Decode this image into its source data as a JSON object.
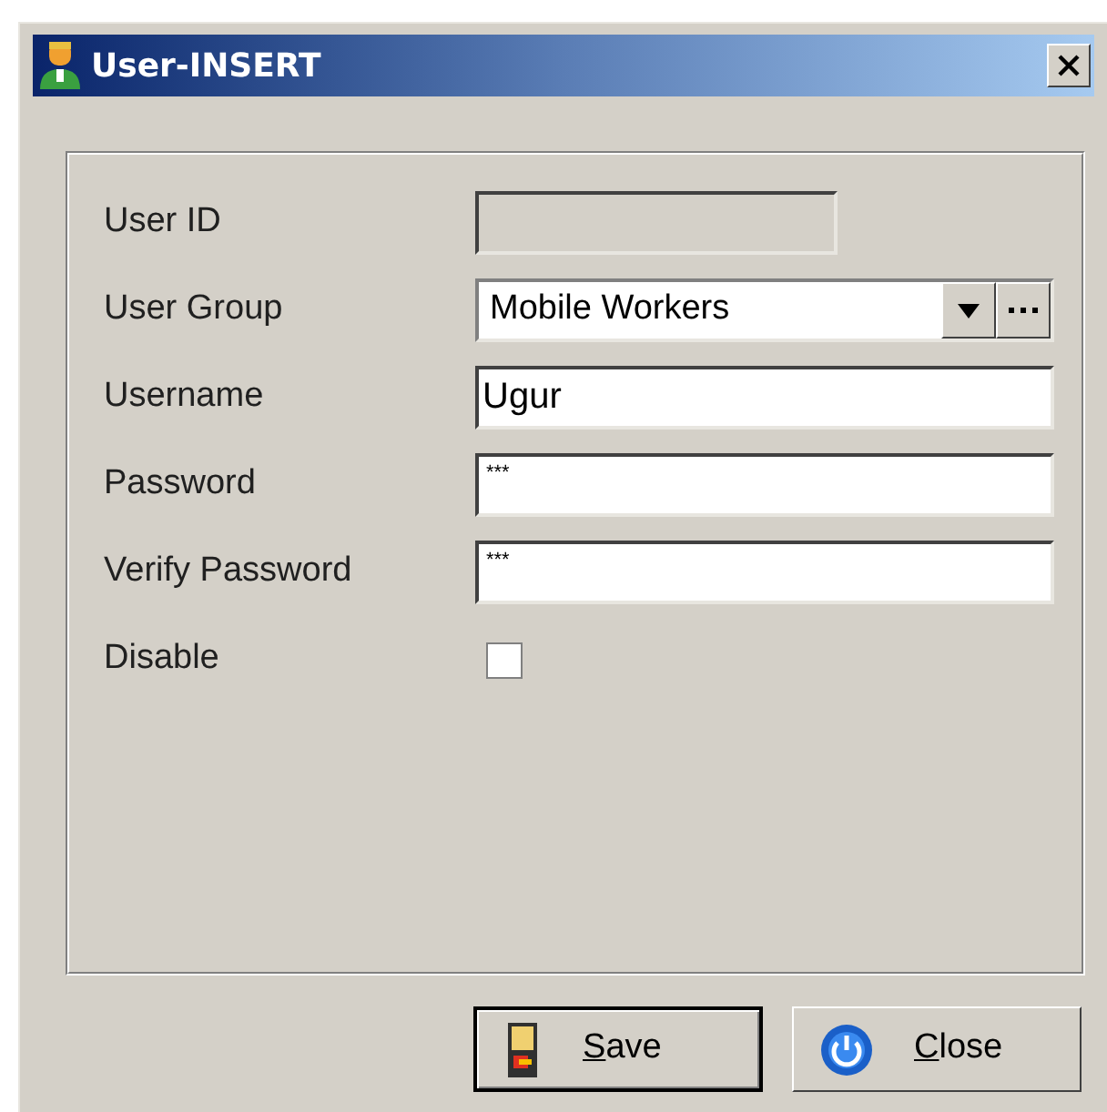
{
  "window": {
    "title": "User-INSERT"
  },
  "fields": [
    {
      "kind": "text",
      "label": "User ID",
      "disabled": true
    },
    {
      "kind": "combo",
      "label": "User Group",
      "value": "Mobile Workers"
    },
    {
      "kind": "text",
      "label": "Username",
      "value": "Ugur"
    },
    {
      "kind": "password",
      "label": "Password",
      "value": "***"
    },
    {
      "kind": "password",
      "label": "Verify Password",
      "value": "***"
    },
    {
      "kind": "checkbox",
      "label": "Disable",
      "checked": false
    }
  ],
  "buttons": [
    {
      "kind": "save",
      "label": "Save",
      "default": true
    },
    {
      "kind": "close",
      "label": "Close",
      "default": false
    }
  ]
}
